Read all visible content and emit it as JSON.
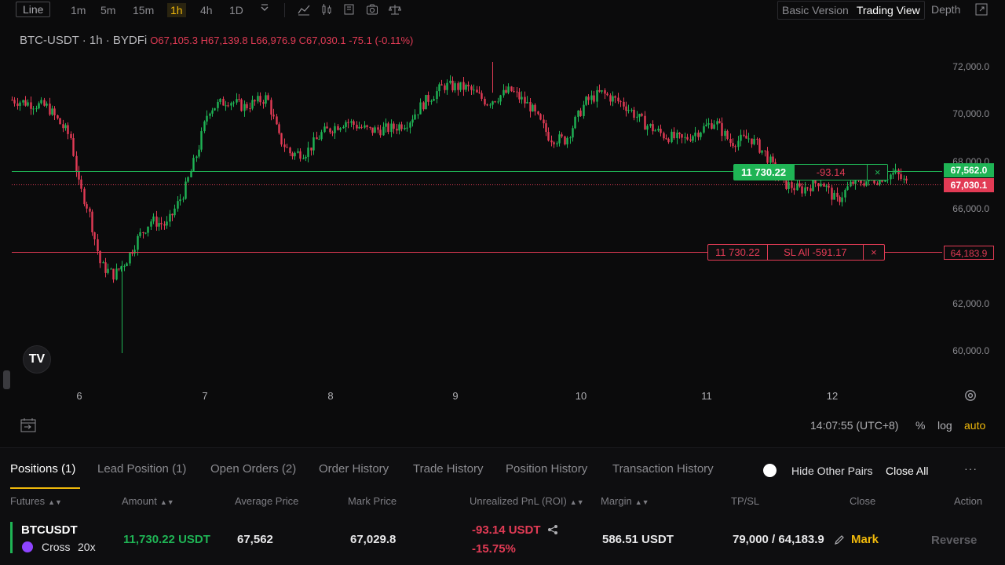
{
  "toolbar": {
    "line_label": "Line",
    "timeframes": [
      "1m",
      "5m",
      "15m",
      "1h",
      "4h",
      "1D"
    ],
    "active_timeframe": "1h",
    "basic_version": "Basic Version",
    "trading_view": "Trading View",
    "depth": "Depth"
  },
  "symbol": {
    "name": "BTC-USDT · 1h · BYDFi",
    "ohlc": "O67,105.3 H67,139.8 L66,976.9 C67,030.1 -75.1 (-0.11%)"
  },
  "chart": {
    "price_labels": [
      "72,000.0",
      "70,000.0",
      "68,000.0",
      "66,000.0",
      "62,000.0",
      "60,000.0"
    ],
    "time_labels": [
      "6",
      "7",
      "8",
      "9",
      "10",
      "11",
      "12"
    ],
    "entry_price_tag": "67,562.0",
    "last_price_tag": "67,030.1",
    "sl_price_tag": "64,183.9",
    "position_amount": "11 730.22",
    "position_pnl": "-93.14",
    "sl_amount": "11 730.22",
    "sl_text": "SL All -591.17",
    "close_glyph": "×",
    "tv_logo": "TV"
  },
  "footer": {
    "clock": "14:07:55 (UTC+8)",
    "percent": "%",
    "log": "log",
    "auto": "auto"
  },
  "panel": {
    "tabs": [
      "Positions (1)",
      "Lead Position (1)",
      "Open Orders (2)",
      "Order History",
      "Trade History",
      "Position History",
      "Transaction History"
    ],
    "hide_other_pairs": "Hide Other Pairs",
    "close_all": "Close All",
    "more": "···",
    "columns": [
      "Futures",
      "Amount",
      "Average Price",
      "Mark Price",
      "Unrealized PnL (ROI)",
      "Margin",
      "TP/SL",
      "Close",
      "Action"
    ],
    "row": {
      "symbol": "BTCUSDT",
      "margin_mode": "Cross",
      "leverage": "20x",
      "amount": "11,730.22 USDT",
      "avg_price": "67,562",
      "mark_price": "67,029.8",
      "pnl": "-93.14 USDT",
      "roi": "-15.75%",
      "margin": "586.51 USDT",
      "tpsl": "79,000 / 64,183.9",
      "close": "Mark",
      "action": "Reverse"
    }
  },
  "colors": {
    "up": "#1fb455",
    "down": "#e23b55",
    "accent": "#f0b90b",
    "background": "#0b0b0c"
  }
}
